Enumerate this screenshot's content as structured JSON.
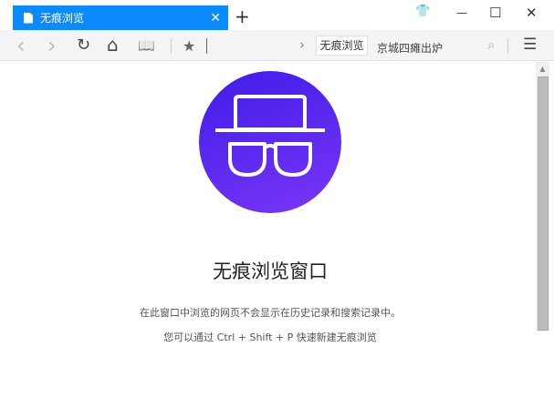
{
  "tab": {
    "title": "无痕浏览",
    "close": "✕"
  },
  "new_tab": "+",
  "window": {
    "skin": "👕",
    "minimize": "—",
    "maximize": "☐",
    "close": "✕"
  },
  "toolbar": {
    "back": "‹",
    "forward": "›",
    "reload": "↻",
    "home": "⌂",
    "reader": "📖",
    "star": "★",
    "arrow": "›",
    "address_tag": "无痕浏览",
    "hot_search": "京城四瘫出炉",
    "search": "⌕",
    "menu": "☰"
  },
  "main": {
    "title": "无痕浏览窗口",
    "line1": "在此窗口中浏览的网页不会显示在历史记录和搜索记录中。",
    "line2": "您可以通过 Ctrl + Shift + P 快速新建无痕浏览"
  },
  "colors": {
    "tab": "#0b8bff",
    "circle_start": "#3f1de8",
    "circle_end": "#7a36f6"
  }
}
